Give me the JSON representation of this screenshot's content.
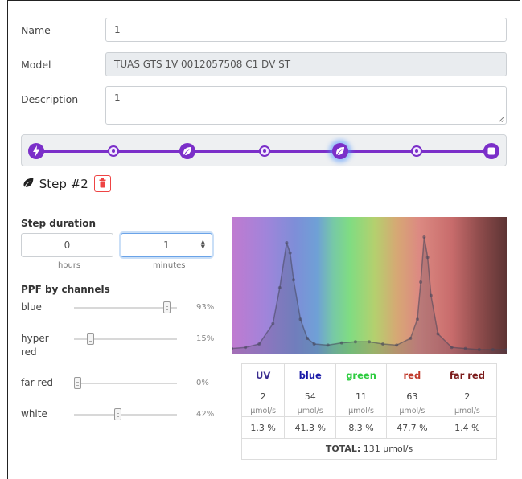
{
  "form": {
    "name_label": "Name",
    "name_value": "1",
    "model_label": "Model",
    "model_value": "TUAS GTS 1V 0012057508 C1 DV ST",
    "description_label": "Description",
    "description_value": "1"
  },
  "stepbar": {
    "accent_color": "#7b2fc9",
    "active_glow_color": "#5096ff",
    "nodes": [
      {
        "icon": "lightning-icon",
        "kind": "big"
      },
      {
        "icon": "add-step-icon",
        "kind": "small"
      },
      {
        "icon": "leaf-icon",
        "kind": "big"
      },
      {
        "icon": "add-step-icon",
        "kind": "small"
      },
      {
        "icon": "leaf-icon",
        "kind": "big",
        "active": true
      },
      {
        "icon": "add-step-icon",
        "kind": "small"
      },
      {
        "icon": "stop-icon",
        "kind": "big"
      }
    ]
  },
  "step": {
    "title": "Step #2",
    "icon": "leaf-icon",
    "delete_icon": "trash-icon",
    "delete_color": "#e44444"
  },
  "duration": {
    "label": "Step duration",
    "hours_value": "0",
    "hours_label": "hours",
    "minutes_value": "1",
    "minutes_label": "minutes"
  },
  "ppf": {
    "label": "PPF by channels",
    "channels": [
      {
        "name": "blue",
        "value": 0.93,
        "pct": "93%"
      },
      {
        "name": "hyper red",
        "value": 0.15,
        "pct": "15%"
      },
      {
        "name": "far red",
        "value": 0.0,
        "pct": "0%"
      },
      {
        "name": "white",
        "value": 0.42,
        "pct": "42%"
      }
    ]
  },
  "table": {
    "headers": [
      {
        "label": "UV",
        "color": "#3a2d8f"
      },
      {
        "label": "blue",
        "color": "#1a1aa8"
      },
      {
        "label": "green",
        "color": "#2ecc40"
      },
      {
        "label": "red",
        "color": "#c0392b"
      },
      {
        "label": "far red",
        "color": "#7b1a1a"
      }
    ],
    "values": [
      "2",
      "54",
      "11",
      "63",
      "2"
    ],
    "units": [
      "µmol/s",
      "µmol/s",
      "µmol/s",
      "µmol/s",
      "µmol/s"
    ],
    "percents": [
      "1.3 %",
      "41.3 %",
      "8.3 %",
      "47.7 %",
      "1.4 %"
    ],
    "total_label": "TOTAL:",
    "total_value": "131 µmol/s"
  },
  "chart_data": {
    "type": "line",
    "title": "",
    "xlabel": "",
    "ylabel": "",
    "grid": false,
    "x": [
      380,
      400,
      420,
      440,
      450,
      460,
      465,
      470,
      480,
      490,
      500,
      520,
      540,
      560,
      580,
      600,
      620,
      640,
      650,
      655,
      660,
      665,
      670,
      680,
      700,
      720,
      740,
      760,
      780
    ],
    "y": [
      0.01,
      0.02,
      0.05,
      0.23,
      0.55,
      0.95,
      0.86,
      0.62,
      0.27,
      0.1,
      0.05,
      0.04,
      0.06,
      0.07,
      0.07,
      0.05,
      0.04,
      0.1,
      0.27,
      0.6,
      1.0,
      0.82,
      0.48,
      0.14,
      0.02,
      0.01,
      0.0,
      0.0,
      0.0
    ],
    "ylim": [
      0,
      1.05
    ],
    "xlim": [
      380,
      780
    ]
  }
}
